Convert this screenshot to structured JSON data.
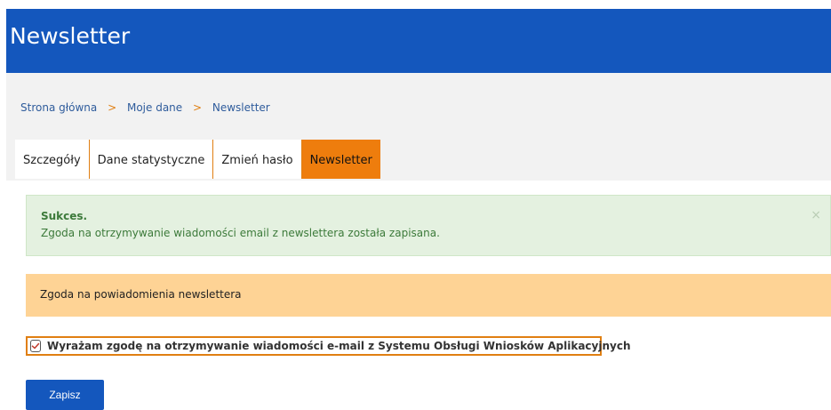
{
  "header": {
    "title": "Newsletter"
  },
  "breadcrumb": {
    "items": [
      "Strona główna",
      "Moje dane",
      "Newsletter"
    ],
    "separator": ">"
  },
  "tabs": [
    {
      "label": "Szczegóły",
      "active": false
    },
    {
      "label": "Dane statystyczne",
      "active": false
    },
    {
      "label": "Zmień hasło",
      "active": false
    },
    {
      "label": "Newsletter",
      "active": true
    }
  ],
  "alert_success": {
    "title": "Sukces.",
    "text": "Zgoda na otrzymywanie wiadomości email z newslettera została zapisana.",
    "close_icon": "×"
  },
  "alert_info": {
    "text": "Zgoda na powiadomienia newslettera"
  },
  "consent": {
    "label": "Wyrażam zgodę na otrzymywanie wiadomości e-mail z Systemu Obsługi Wniosków Aplikacyjnych",
    "checked": true
  },
  "form": {
    "save_label": "Zapisz"
  },
  "colors": {
    "header": "#1457bd",
    "accent": "#ee7d0d",
    "success_bg": "#e4f1e0",
    "warning_bg": "#fed395"
  }
}
